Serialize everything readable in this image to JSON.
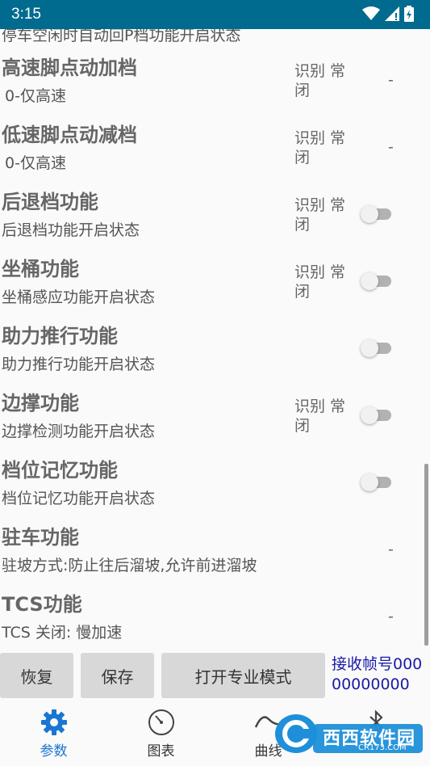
{
  "status_bar": {
    "time": "3:15"
  },
  "partial_row_text": "停车空闲时自动回P档功能开启状态",
  "rows": [
    {
      "title": "高速脚点动加档",
      "subtitle": "0-仅高速",
      "status": "识别 常闭",
      "value": "-"
    },
    {
      "title": "低速脚点动减档",
      "subtitle": "0-仅高速",
      "status": "识别 常闭",
      "value": "-"
    },
    {
      "title": "后退档功能",
      "subtitle": "后退档功能开启状态",
      "status": "识别 常闭",
      "toggle_on": false
    },
    {
      "title": "坐桶功能",
      "subtitle": "坐桶感应功能开启状态",
      "status": "识别 常闭",
      "toggle_on": false
    },
    {
      "title": "助力推行功能",
      "subtitle": "助力推行功能开启状态",
      "toggle_on": false
    },
    {
      "title": "边撑功能",
      "subtitle": "边撑检测功能开启状态",
      "status": "识别 常闭",
      "toggle_on": false
    },
    {
      "title": "档位记忆功能",
      "subtitle": "档位记忆功能开启状态",
      "toggle_on": false
    },
    {
      "title": "驻车功能",
      "subtitle": "驻坡方式:防止往后溜坡,允许前进溜坡",
      "value": "-"
    },
    {
      "title": "TCS功能",
      "subtitle": "TCS 关闭: 慢加速",
      "value": "-"
    }
  ],
  "actions": {
    "restore_label": "恢复",
    "save_label": "保存",
    "pro_mode_label": "打开专业模式",
    "frame_text": "接收帧号00000000000"
  },
  "nav": {
    "params_label": "参数",
    "chart_label": "图表",
    "curve_label": "曲线"
  },
  "watermark": {
    "text": "西西软件园",
    "url": "CR173.COM"
  },
  "colors": {
    "status_bar": "#006b8f",
    "accent": "#1976d2",
    "frame_text": "#1a1aa6"
  }
}
